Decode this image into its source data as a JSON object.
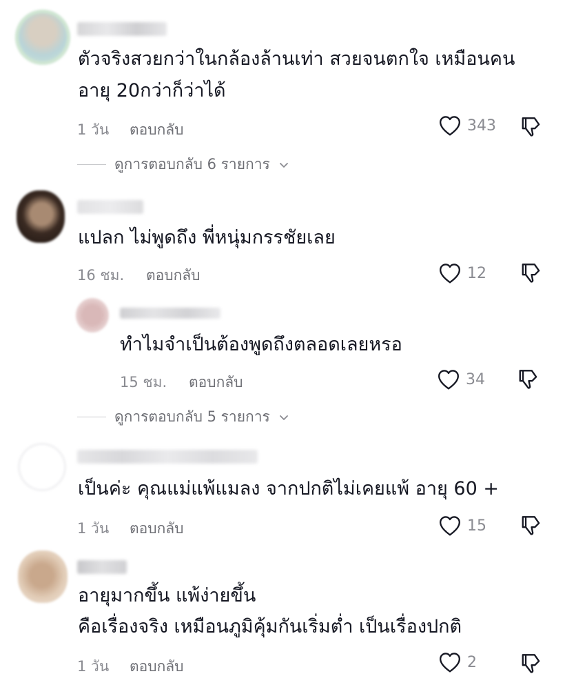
{
  "comments": [
    {
      "text_lines": [
        "ตัวจริงสวยกว่าในกล้องล้านเท่า สวยจนตกใจ เหมือนคน",
        "อายุ 20กว่าก็ว่าได้"
      ],
      "time": "1 วัน",
      "reply_label": "ตอบกลับ",
      "likes": "343",
      "view_replies": "ดูการตอบกลับ 6 รายการ"
    },
    {
      "text_lines": [
        "แปลก ไม่พูดถึง พี่หนุ่มกรรชัยเลย"
      ],
      "time": "16 ชม.",
      "reply_label": "ตอบกลับ",
      "likes": "12",
      "replies": [
        {
          "text_lines": [
            "ทำไมจำเป็นต้องพูดถึงตลอดเลยหรอ"
          ],
          "time": "15 ชม.",
          "reply_label": "ตอบกลับ",
          "likes": "34"
        }
      ],
      "view_replies": "ดูการตอบกลับ 5 รายการ"
    },
    {
      "text_lines": [
        "เป็นค่ะ คุณแม่แพ้แมลง จากปกติไม่เคยแพ้ อายุ 60 +"
      ],
      "time": "1 วัน",
      "reply_label": "ตอบกลับ",
      "likes": "15"
    },
    {
      "text_lines": [
        "อายุมากขึ้น แพ้ง่ายขึ้น",
        "คือเรื่องจริง เหมือนภูมิคุ้มกันเริ่มต่ำ เป็นเรื่องปกติ"
      ],
      "time": "1 วัน",
      "reply_label": "ตอบกลับ",
      "likes": "2"
    }
  ],
  "icons": {
    "like": "heart-outline-icon",
    "dislike": "thumbs-down-outline-icon",
    "expand": "chevron-down-icon"
  },
  "colors": {
    "text": "#161823",
    "secondary": "#8a8b91",
    "icon": "#161823"
  }
}
